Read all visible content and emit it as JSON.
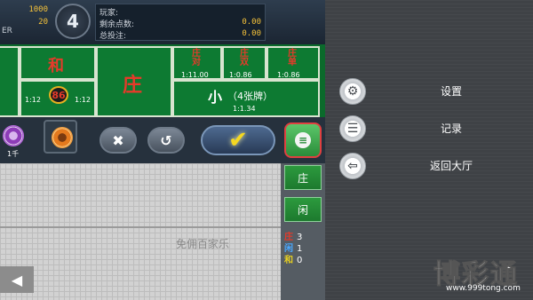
{
  "stats": {
    "value1": "1000",
    "value2": "20",
    "player_suffix": "ER"
  },
  "round": {
    "number": "4"
  },
  "info": {
    "player_label": "玩家:",
    "remaining_label": "剩余点数:",
    "remaining_value": "0.00",
    "total_bet_label": "总投注:",
    "total_bet_value": "0.00"
  },
  "board": {
    "tie_label": "和",
    "tie_odds_left": "1:12",
    "tie_odds_right": "1:12",
    "super6_badge": "86",
    "banker_label": "庄",
    "banker_pair_label": "庄对",
    "banker_pair_odds": "1:11.00",
    "banker_double_label": "庄双",
    "banker_double_odds": "1:0.86",
    "banker_single_label": "庄单",
    "banker_single_odds": "1:0.86",
    "small_label": "小",
    "small_sub": "（4张牌）",
    "small_odds": "1:1.34"
  },
  "chips": {
    "chip1_label": "1千"
  },
  "controls": {
    "cancel_icon": "close-icon",
    "undo_icon": "undo-icon",
    "confirm_icon": "check-icon"
  },
  "side": {
    "zhuang_label": "庄",
    "xian_label": "闲",
    "counts": [
      {
        "label": "庄",
        "value": "3",
        "color": "#e53a2a"
      },
      {
        "label": "闲",
        "value": "1",
        "color": "#4aa8ff"
      },
      {
        "label": "和",
        "value": "0",
        "color": "#e7d020"
      }
    ]
  },
  "watermark": "免佣百家乐",
  "menu": {
    "items": [
      {
        "label": "设置",
        "icon": "gear-icon"
      },
      {
        "label": "记录",
        "icon": "list-icon"
      },
      {
        "label": "返回大厅",
        "icon": "exit-icon"
      }
    ]
  },
  "logo": {
    "text": "博彩通",
    "url": "www.999tong.com"
  }
}
